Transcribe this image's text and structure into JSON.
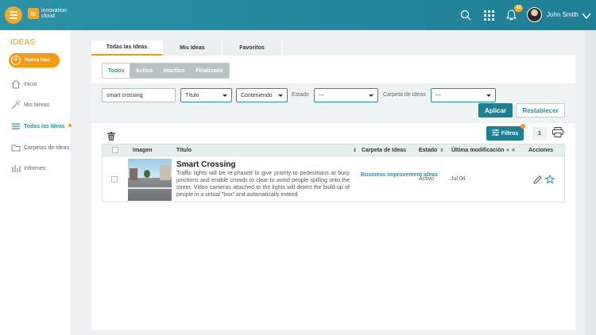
{
  "header": {
    "logo_line1": "innovation",
    "logo_line2": "cloud",
    "logo_mark": "ic",
    "notification_count": "41",
    "user_name": "John Smith"
  },
  "sidebar": {
    "title": "IDEAS",
    "new_idea_label": "Nueva Idea",
    "items": [
      {
        "label": "Inicio",
        "icon": "home-icon"
      },
      {
        "label": "Mis tareas",
        "icon": "tasks-icon"
      },
      {
        "label": "Todas las Ideas",
        "icon": "list-icon"
      },
      {
        "label": "Carpetas de Ideas",
        "icon": "folder-icon"
      },
      {
        "label": "Informes",
        "icon": "chart-icon"
      }
    ]
  },
  "tabs": [
    "Todas las Ideas",
    "Mis Ideas",
    "Favoritos"
  ],
  "status_filter": [
    "Todos",
    "Activo",
    "Inactivo",
    "Finalizado"
  ],
  "filters": {
    "search_value": "smart crossing",
    "field_select": "Título",
    "mode_select": "Conteniendo",
    "estado_label": "Estado",
    "estado_value": "---",
    "folder_label": "Carpeta de Ideas",
    "folder_value": "---",
    "apply": "Aplicar",
    "reset": "Restablecer"
  },
  "toolbar": {
    "filters_button": "Filtros",
    "count": "1"
  },
  "table": {
    "columns": [
      "Imagen",
      "Título",
      "Carpeta de Ideas",
      "Estado",
      "Última modificación",
      "Acciones"
    ],
    "rows": [
      {
        "title": "Smart Crossing",
        "description": "Traffic lights will be re-phased to give priority to pedestrians at busy junctions and enable crowds to clear to avoid people spilling onto the street. Video cameras attached to the lights will detect the build-up of people in a virtual \"box\" and automatically extend",
        "folder": "Business improvement ideas",
        "status": "Activo",
        "modified": "Jul 04"
      }
    ]
  },
  "colors": {
    "topbar": "#2b93a6",
    "accent": "#f39c12",
    "primary": "#1f7f94"
  }
}
